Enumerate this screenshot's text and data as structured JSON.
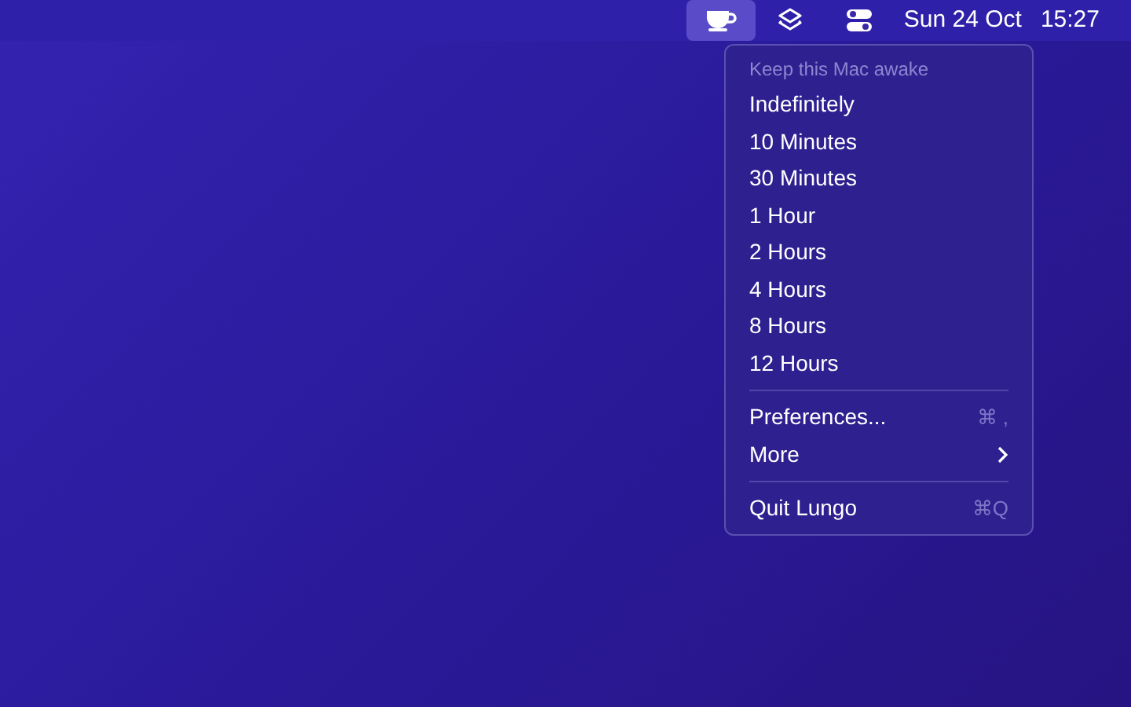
{
  "menu_bar": {
    "status_items": [
      {
        "kind": "cup",
        "selected": true
      },
      {
        "kind": "layers",
        "selected": false
      },
      {
        "kind": "toggles",
        "selected": false
      }
    ],
    "date": "Sun 24 Oct",
    "time": "15:27"
  },
  "menu": {
    "items": [
      {
        "kind": "header",
        "label": "Keep this Mac awake"
      },
      {
        "kind": "item",
        "label": "Indefinitely"
      },
      {
        "kind": "item",
        "label": "10 Minutes"
      },
      {
        "kind": "item",
        "label": "30 Minutes"
      },
      {
        "kind": "item",
        "label": "1 Hour"
      },
      {
        "kind": "item",
        "label": "2 Hours"
      },
      {
        "kind": "item",
        "label": "4 Hours"
      },
      {
        "kind": "item",
        "label": "8 Hours"
      },
      {
        "kind": "item",
        "label": "12 Hours"
      },
      {
        "kind": "separator"
      },
      {
        "kind": "item",
        "label": "Preferences...",
        "shortcut": "⌘ ,"
      },
      {
        "kind": "submenu",
        "label": "More"
      },
      {
        "kind": "separator"
      },
      {
        "kind": "item",
        "label": "Quit Lungo",
        "shortcut": "⌘Q"
      }
    ]
  }
}
